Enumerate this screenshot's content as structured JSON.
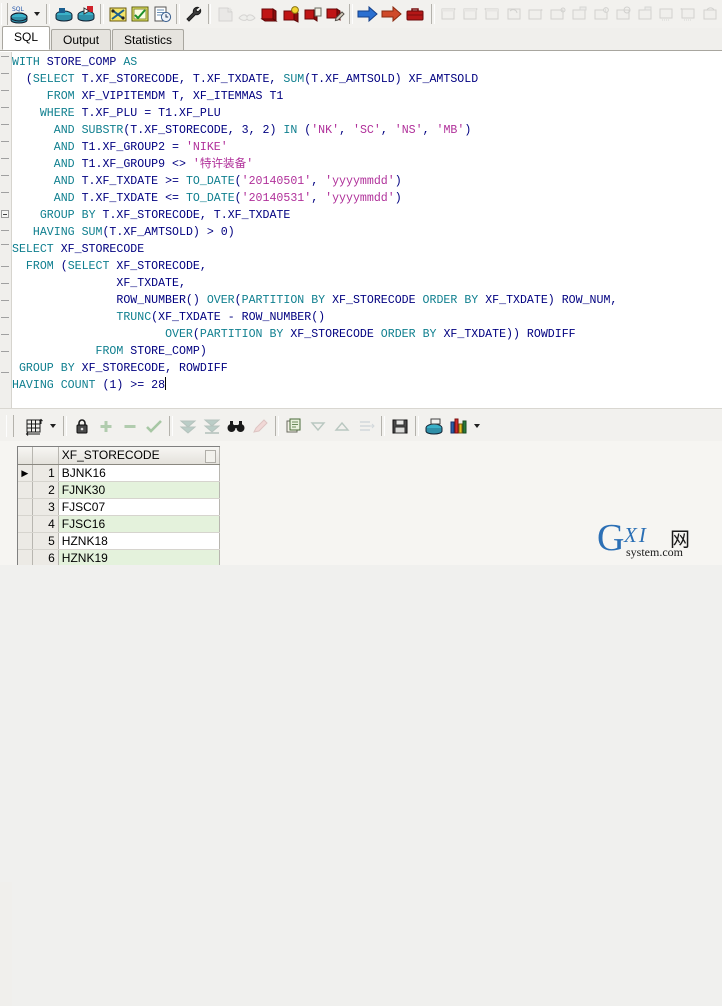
{
  "window": {
    "title": "SQL Editor"
  },
  "toolbar": {
    "groups": [
      {
        "name": "sql-group",
        "buttons": [
          {
            "name": "new-sql-window-icon",
            "label": "New SQL Window",
            "state": "enabled"
          },
          {
            "name": "sql-dropdown-caret-icon",
            "label": "SQL Window Options",
            "state": "enabled"
          }
        ]
      },
      {
        "name": "open-save-group",
        "buttons": [
          {
            "name": "open-file-icon",
            "label": "Open",
            "state": "enabled"
          },
          {
            "name": "save-file-icon",
            "label": "Save",
            "state": "enabled"
          }
        ]
      },
      {
        "name": "execute-group",
        "buttons": [
          {
            "name": "execute-icon",
            "label": "Execute",
            "state": "enabled"
          },
          {
            "name": "explain-plan-icon",
            "label": "Explain Plan",
            "state": "enabled"
          },
          {
            "name": "history-icon",
            "label": "History",
            "state": "enabled"
          }
        ]
      },
      {
        "name": "tools-group",
        "buttons": [
          {
            "name": "wrench-icon",
            "label": "Tools",
            "state": "enabled"
          }
        ]
      },
      {
        "name": "session-group",
        "buttons": [
          {
            "name": "new-session-icon",
            "label": "New Session",
            "state": "disabled"
          },
          {
            "name": "clear-icon",
            "label": "Clear",
            "state": "disabled"
          },
          {
            "name": "commit-icon",
            "label": "Commit",
            "state": "enabled"
          },
          {
            "name": "rollback-icon",
            "label": "Rollback",
            "state": "enabled"
          },
          {
            "name": "copy-object-icon",
            "label": "Copy",
            "state": "enabled"
          },
          {
            "name": "paste-object-icon",
            "label": "Paste",
            "state": "enabled"
          }
        ]
      },
      {
        "name": "navigation-group",
        "buttons": [
          {
            "name": "forward-arrow-icon",
            "label": "Next",
            "state": "enabled"
          },
          {
            "name": "back-arrow-icon",
            "label": "Previous",
            "state": "enabled"
          },
          {
            "name": "briefcase-icon",
            "label": "Projects",
            "state": "enabled"
          }
        ]
      },
      {
        "name": "window-list-group",
        "buttons": [
          {
            "name": "window-icon-1",
            "label": "Window 1",
            "state": "disabled"
          },
          {
            "name": "window-icon-2",
            "label": "Window 2",
            "state": "disabled"
          },
          {
            "name": "window-icon-3",
            "label": "Window 3",
            "state": "disabled"
          },
          {
            "name": "window-icon-4",
            "label": "Window 4",
            "state": "disabled"
          },
          {
            "name": "window-icon-5",
            "label": "Window 5",
            "state": "disabled"
          },
          {
            "name": "window-icon-6",
            "label": "Window 6",
            "state": "disabled"
          },
          {
            "name": "window-icon-7",
            "label": "Window 7",
            "state": "disabled"
          },
          {
            "name": "window-icon-8",
            "label": "Window 8",
            "state": "disabled"
          },
          {
            "name": "window-icon-9",
            "label": "Window 9",
            "state": "disabled"
          },
          {
            "name": "window-icon-10",
            "label": "Window 10",
            "state": "disabled"
          },
          {
            "name": "window-icon-11",
            "label": "Window 11",
            "state": "disabled"
          },
          {
            "name": "window-icon-12",
            "label": "Window 12",
            "state": "disabled"
          },
          {
            "name": "window-icon-13",
            "label": "Window 13",
            "state": "disabled"
          }
        ]
      }
    ]
  },
  "tabs": [
    {
      "label": "SQL",
      "active": true
    },
    {
      "label": "Output",
      "active": false
    },
    {
      "label": "Statistics",
      "active": false
    }
  ],
  "editor": {
    "cursor_visible": true,
    "lines": [
      [
        [
          "kw",
          "WITH"
        ],
        [
          "id",
          " STORE_COMP "
        ],
        [
          "kw",
          "AS"
        ]
      ],
      [
        [
          "id",
          "  ("
        ],
        [
          "kw",
          "SELECT"
        ],
        [
          "id",
          " T.XF_STORECODE, T.XF_TXDATE, "
        ],
        [
          "kw",
          "SUM"
        ],
        [
          "id",
          "(T.XF_AMTSOLD) XF_AMTSOLD"
        ]
      ],
      [
        [
          "id",
          "     "
        ],
        [
          "kw",
          "FROM"
        ],
        [
          "id",
          " XF_VIPITEMDM T, XF_ITEMMAS T1"
        ]
      ],
      [
        [
          "id",
          "    "
        ],
        [
          "kw",
          "WHERE"
        ],
        [
          "id",
          " T.XF_PLU = T1.XF_PLU"
        ]
      ],
      [
        [
          "id",
          "      "
        ],
        [
          "kw",
          "AND"
        ],
        [
          "id",
          " "
        ],
        [
          "kw",
          "SUBSTR"
        ],
        [
          "id",
          "(T.XF_STORECODE, 3, 2) "
        ],
        [
          "kw",
          "IN"
        ],
        [
          "id",
          " ("
        ],
        [
          "st",
          "'NK'"
        ],
        [
          "id",
          ", "
        ],
        [
          "st",
          "'SC'"
        ],
        [
          "id",
          ", "
        ],
        [
          "st",
          "'NS'"
        ],
        [
          "id",
          ", "
        ],
        [
          "st",
          "'MB'"
        ],
        [
          "id",
          ")"
        ]
      ],
      [
        [
          "id",
          "      "
        ],
        [
          "kw",
          "AND"
        ],
        [
          "id",
          " T1.XF_GROUP2 = "
        ],
        [
          "st",
          "'NIKE'"
        ]
      ],
      [
        [
          "id",
          "      "
        ],
        [
          "kw",
          "AND"
        ],
        [
          "id",
          " T1.XF_GROUP9 <> "
        ],
        [
          "st",
          "'特许装备'"
        ]
      ],
      [
        [
          "id",
          "      "
        ],
        [
          "kw",
          "AND"
        ],
        [
          "id",
          " T.XF_TXDATE >= "
        ],
        [
          "kw",
          "TO_DATE"
        ],
        [
          "id",
          "("
        ],
        [
          "st",
          "'20140501'"
        ],
        [
          "id",
          ", "
        ],
        [
          "st",
          "'yyyymmdd'"
        ],
        [
          "id",
          ")"
        ]
      ],
      [
        [
          "id",
          "      "
        ],
        [
          "kw",
          "AND"
        ],
        [
          "id",
          " T.XF_TXDATE <= "
        ],
        [
          "kw",
          "TO_DATE"
        ],
        [
          "id",
          "("
        ],
        [
          "st",
          "'20140531'"
        ],
        [
          "id",
          ", "
        ],
        [
          "st",
          "'yyyymmdd'"
        ],
        [
          "id",
          ")"
        ]
      ],
      [
        [
          "id",
          "    "
        ],
        [
          "kw",
          "GROUP"
        ],
        [
          "id",
          " "
        ],
        [
          "kw",
          "BY"
        ],
        [
          "id",
          " T.XF_STORECODE, T.XF_TXDATE"
        ]
      ],
      [
        [
          "id",
          "   "
        ],
        [
          "kw",
          "HAVING"
        ],
        [
          "id",
          " "
        ],
        [
          "kw",
          "SUM"
        ],
        [
          "id",
          "(T.XF_AMTSOLD) > 0)"
        ]
      ],
      [
        [
          "kw",
          "SELECT"
        ],
        [
          "id",
          " XF_STORECODE"
        ]
      ],
      [
        [
          "id",
          "  "
        ],
        [
          "kw",
          "FROM"
        ],
        [
          "id",
          " ("
        ],
        [
          "kw",
          "SELECT"
        ],
        [
          "id",
          " XF_STORECODE,"
        ]
      ],
      [
        [
          "id",
          "               XF_TXDATE,"
        ]
      ],
      [
        [
          "id",
          "               ROW_NUMBER() "
        ],
        [
          "kw",
          "OVER"
        ],
        [
          "id",
          "("
        ],
        [
          "kw",
          "PARTITION"
        ],
        [
          "id",
          " "
        ],
        [
          "kw",
          "BY"
        ],
        [
          "id",
          " XF_STORECODE "
        ],
        [
          "kw",
          "ORDER"
        ],
        [
          "id",
          " "
        ],
        [
          "kw",
          "BY"
        ],
        [
          "id",
          " XF_TXDATE) ROW_NUM,"
        ]
      ],
      [
        [
          "id",
          "               "
        ],
        [
          "kw",
          "TRUNC"
        ],
        [
          "id",
          "(XF_TXDATE - ROW_NUMBER()"
        ]
      ],
      [
        [
          "id",
          "                      "
        ],
        [
          "kw",
          "OVER"
        ],
        [
          "id",
          "("
        ],
        [
          "kw",
          "PARTITION"
        ],
        [
          "id",
          " "
        ],
        [
          "kw",
          "BY"
        ],
        [
          "id",
          " XF_STORECODE "
        ],
        [
          "kw",
          "ORDER"
        ],
        [
          "id",
          " "
        ],
        [
          "kw",
          "BY"
        ],
        [
          "id",
          " XF_TXDATE)) ROWDIFF"
        ]
      ],
      [
        [
          "id",
          "            "
        ],
        [
          "kw",
          "FROM"
        ],
        [
          "id",
          " STORE_COMP)"
        ]
      ],
      [
        [
          "id",
          " "
        ],
        [
          "kw",
          "GROUP"
        ],
        [
          "id",
          " "
        ],
        [
          "kw",
          "BY"
        ],
        [
          "id",
          " XF_STORECODE, ROWDIFF"
        ]
      ],
      [
        [
          "kw",
          "HAVING"
        ],
        [
          "id",
          " "
        ],
        [
          "kw",
          "COUNT"
        ],
        [
          "id",
          " (1) >= 28"
        ]
      ]
    ]
  },
  "grid_toolbar": {
    "buttons": [
      {
        "name": "grid-layout-icon",
        "label": "Grid Layout",
        "state": "enabled"
      },
      {
        "name": "grid-layout-caret-icon",
        "label": "Grid Layout Options",
        "state": "enabled"
      },
      {
        "name": "lock-icon",
        "label": "Lock Record",
        "state": "enabled"
      },
      {
        "name": "add-row-icon",
        "label": "Insert Row",
        "state": "disabled"
      },
      {
        "name": "remove-row-icon",
        "label": "Delete Row",
        "state": "disabled"
      },
      {
        "name": "post-changes-icon",
        "label": "Post Changes",
        "state": "disabled"
      },
      {
        "name": "fetch-next-page-icon",
        "label": "Fetch Next Page",
        "state": "disabled"
      },
      {
        "name": "fetch-all-icon",
        "label": "Fetch All",
        "state": "disabled"
      },
      {
        "name": "find-binoculars-icon",
        "label": "Find",
        "state": "enabled"
      },
      {
        "name": "highlight-icon",
        "label": "Highlight",
        "state": "disabled"
      },
      {
        "name": "copy-records-icon",
        "label": "Copy to Clipboard",
        "state": "enabled"
      },
      {
        "name": "sort-descending-icon",
        "label": "Sort Descending",
        "state": "disabled"
      },
      {
        "name": "sort-ascending-icon",
        "label": "Sort Ascending",
        "state": "disabled"
      },
      {
        "name": "export-icon",
        "label": "Export Data",
        "state": "disabled"
      },
      {
        "name": "save-grid-icon",
        "label": "Save Results",
        "state": "enabled"
      },
      {
        "name": "sql-result-icon",
        "label": "Query Data",
        "state": "enabled"
      },
      {
        "name": "chart-icon",
        "label": "Chart",
        "state": "enabled"
      },
      {
        "name": "chart-caret-icon",
        "label": "Chart Options",
        "state": "enabled"
      }
    ]
  },
  "results": {
    "columns": [
      "XF_STORECODE"
    ],
    "current_row_marker": "▶",
    "rows": [
      {
        "num": "1",
        "XF_STORECODE": "BJNK16",
        "current": true
      },
      {
        "num": "2",
        "XF_STORECODE": "FJNK30",
        "current": false
      },
      {
        "num": "3",
        "XF_STORECODE": "FJSC07",
        "current": false
      },
      {
        "num": "4",
        "XF_STORECODE": "FJSC16",
        "current": false
      },
      {
        "num": "5",
        "XF_STORECODE": "HZNK18",
        "current": false
      },
      {
        "num": "6",
        "XF_STORECODE": "HZNK19",
        "current": false
      }
    ]
  },
  "watermark": {
    "g": "G",
    "xi": "XI",
    "net": "网",
    "system": "system.com"
  },
  "colors": {
    "keyword": "#0f7f8f",
    "identifier": "#000080",
    "string": "#b0309a",
    "grid_alt_row": "#e4f2dc",
    "toolbar_bg": "#f2f1ee"
  }
}
